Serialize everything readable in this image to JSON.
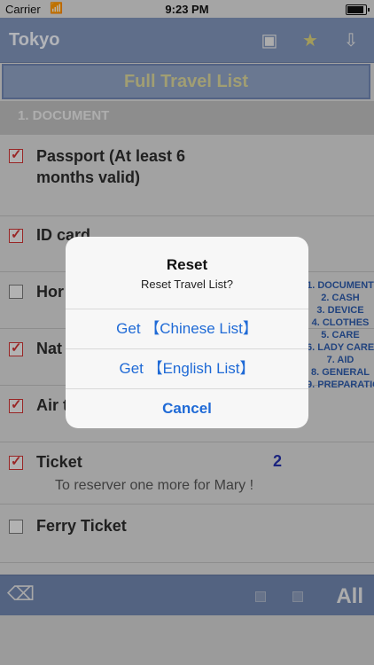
{
  "status_bar": {
    "carrier": "Carrier",
    "time": "9:23 PM"
  },
  "header": {
    "city": "Tokyo",
    "title": "Full Travel List"
  },
  "icons": {
    "note": "note-icon",
    "star": "star-icon",
    "share": "share-icon",
    "back": "backspace-icon"
  },
  "section": {
    "label": "1. DOCUMENT"
  },
  "items": [
    {
      "label": "Passport (At least 6 months valid)",
      "checked": true
    },
    {
      "label": "ID card",
      "checked": true
    },
    {
      "label": "Hor",
      "checked": false
    },
    {
      "label": "Nat",
      "checked": true
    },
    {
      "label": "Air t",
      "checked": true
    },
    {
      "label": "Ticket",
      "checked": true,
      "count": "2",
      "note": "To reserver one more for Mary !"
    },
    {
      "label": "Ferry Ticket",
      "checked": false
    }
  ],
  "index_list": [
    "1. DOCUMENT",
    "2. CASH",
    "3. DEVICE",
    "4. CLOTHES",
    "5. CARE",
    "6. LADY CARE",
    "7. AID",
    "8. GENERAL",
    "9. PREPARATION"
  ],
  "toolbar": {
    "all_label": "All"
  },
  "dialog": {
    "title": "Reset",
    "message": "Reset Travel List?",
    "buttons": [
      "Get 【Chinese List】",
      "Get 【English List】",
      "Cancel"
    ]
  }
}
